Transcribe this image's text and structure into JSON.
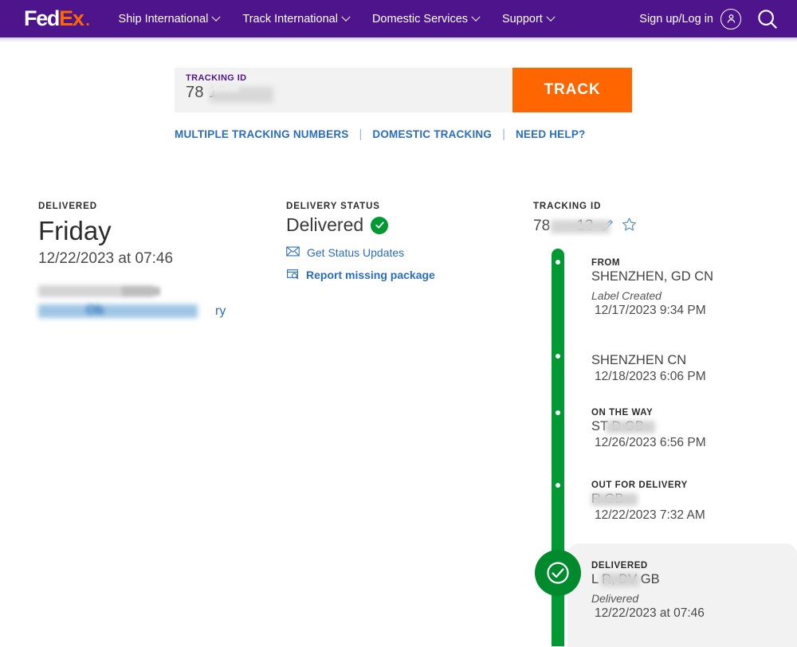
{
  "header": {
    "logo": {
      "part1": "Fed",
      "part2": "Ex",
      "dot": "."
    },
    "nav": [
      {
        "label": "Ship International",
        "icon": "chevron-down-icon"
      },
      {
        "label": "Track International",
        "icon": "chevron-down-icon"
      },
      {
        "label": "Domestic Services",
        "icon": "chevron-down-icon"
      },
      {
        "label": "Support",
        "icon": "chevron-down-icon"
      }
    ],
    "signup_label": "Sign up/Log in",
    "account_icon": "user-account-icon",
    "search_icon": "search-icon",
    "background_color": "#4D148C"
  },
  "search": {
    "field_label": "TRACKING ID",
    "field_value": "78          13",
    "button_label": "TRACK",
    "button_color": "#FF6600",
    "links": [
      "MULTIPLE TRACKING NUMBERS",
      "DOMESTIC TRACKING",
      "NEED HELP?"
    ],
    "link_separator": "|"
  },
  "summary": {
    "heading": "DELIVERED",
    "day": "Friday",
    "datetime": "12/22/2023 at 07:46",
    "redacted_line_tail": "ry"
  },
  "delivery_status": {
    "heading": "DELIVERY STATUS",
    "status": "Delivered",
    "status_icon": "green-check-icon",
    "actions": [
      {
        "label": "Get Status Updates",
        "icon": "envelope-icon",
        "bold": false
      },
      {
        "label": "Report missing package",
        "icon": "package-search-icon",
        "bold": true
      }
    ]
  },
  "tracking": {
    "heading": "TRACKING ID",
    "id_prefix": "78",
    "id_suffix": "13",
    "edit_icon": "pencil-edit-icon",
    "favorite_icon": "star-favorite-icon",
    "timeline_color": "#009933",
    "events": [
      {
        "kind": "FROM",
        "place": "SHENZHEN, GD CN",
        "sub": "Label Created",
        "time": "12/17/2023 9:34 PM",
        "redacted": false
      },
      {
        "kind": "",
        "place": "SHENZHEN CN",
        "sub": "",
        "time": "12/18/2023 6:06 PM",
        "redacted": false
      },
      {
        "kind": "ON THE WAY",
        "place": "ST             D GB",
        "sub": "",
        "time": "12/26/2023 6:56 PM",
        "redacted": true
      },
      {
        "kind": "OUT FOR DELIVERY",
        "place": "           R GB",
        "sub": "",
        "time": "12/22/2023 7:32 AM",
        "redacted": true
      }
    ],
    "final_event": {
      "kind": "DELIVERED",
      "place": "L            R, DV GB",
      "sub": "Delivered",
      "time": "12/22/2023 at 07:46",
      "icon": "green-check-circle-icon"
    }
  }
}
